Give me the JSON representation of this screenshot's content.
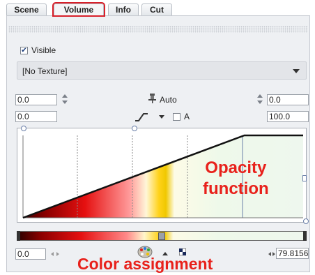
{
  "tabs": [
    {
      "label": "Scene",
      "active": false
    },
    {
      "label": "Volume",
      "active": true
    },
    {
      "label": "Info",
      "active": false
    },
    {
      "label": "Cut",
      "active": false
    }
  ],
  "visible_checkbox": {
    "label": "Visible",
    "checked": true
  },
  "texture_select": {
    "value": "[No Texture]"
  },
  "controls": {
    "left_top_value": "0.0",
    "left_bottom_value": "0.0",
    "auto_label": "Auto",
    "a_label": "A",
    "a_checked": false,
    "right_top_value": "0.0",
    "right_bottom_value": "100.0"
  },
  "opacity_function": {
    "points": [
      [
        0.0,
        0.0
      ],
      [
        0.79,
        1.0
      ],
      [
        1.0,
        1.0
      ]
    ],
    "ymax": 1.0,
    "xmax": 1.0
  },
  "colormap": {
    "stops": [
      "#2a0000",
      "#8a0000",
      "#e51010",
      "#ff8a8a",
      "#fff6cc",
      "#ffd21a",
      "#fdfbe6",
      "#eef9ea"
    ],
    "marker_position": 0.5
  },
  "color_controls": {
    "min_value": "0.0",
    "max_value": "79.8156"
  },
  "annotations": {
    "opacity": "Opacity\nfunction",
    "opacity_line1": "Opacity",
    "opacity_line2": "function",
    "color": "Color assignment"
  },
  "colors": {
    "accent_red": "#e8211b",
    "tab_highlight": "#d8202a"
  },
  "icons": [
    "pin-icon",
    "curve-icon",
    "palette-icon",
    "triangle-up-icon",
    "checker-icon"
  ]
}
